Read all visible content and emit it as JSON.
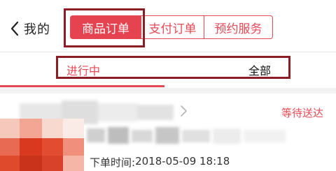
{
  "header": {
    "back_label": "我的",
    "tabs": [
      {
        "label": "商品订单",
        "active": true
      },
      {
        "label": "支付订单",
        "active": false
      },
      {
        "label": "预约服务",
        "active": false
      }
    ]
  },
  "filters": {
    "ongoing": "进行中",
    "all": "全部",
    "active": "ongoing"
  },
  "order": {
    "status": "等待送达",
    "time_label": "下单时间:",
    "time_value": "2018-05-09 18:18"
  },
  "colors": {
    "accent": "#e5434f",
    "annotation": "#8c1d24",
    "divider": "#e6e6e6"
  },
  "icons": [
    "back-chevron-icon",
    "chevron-right-icon"
  ]
}
